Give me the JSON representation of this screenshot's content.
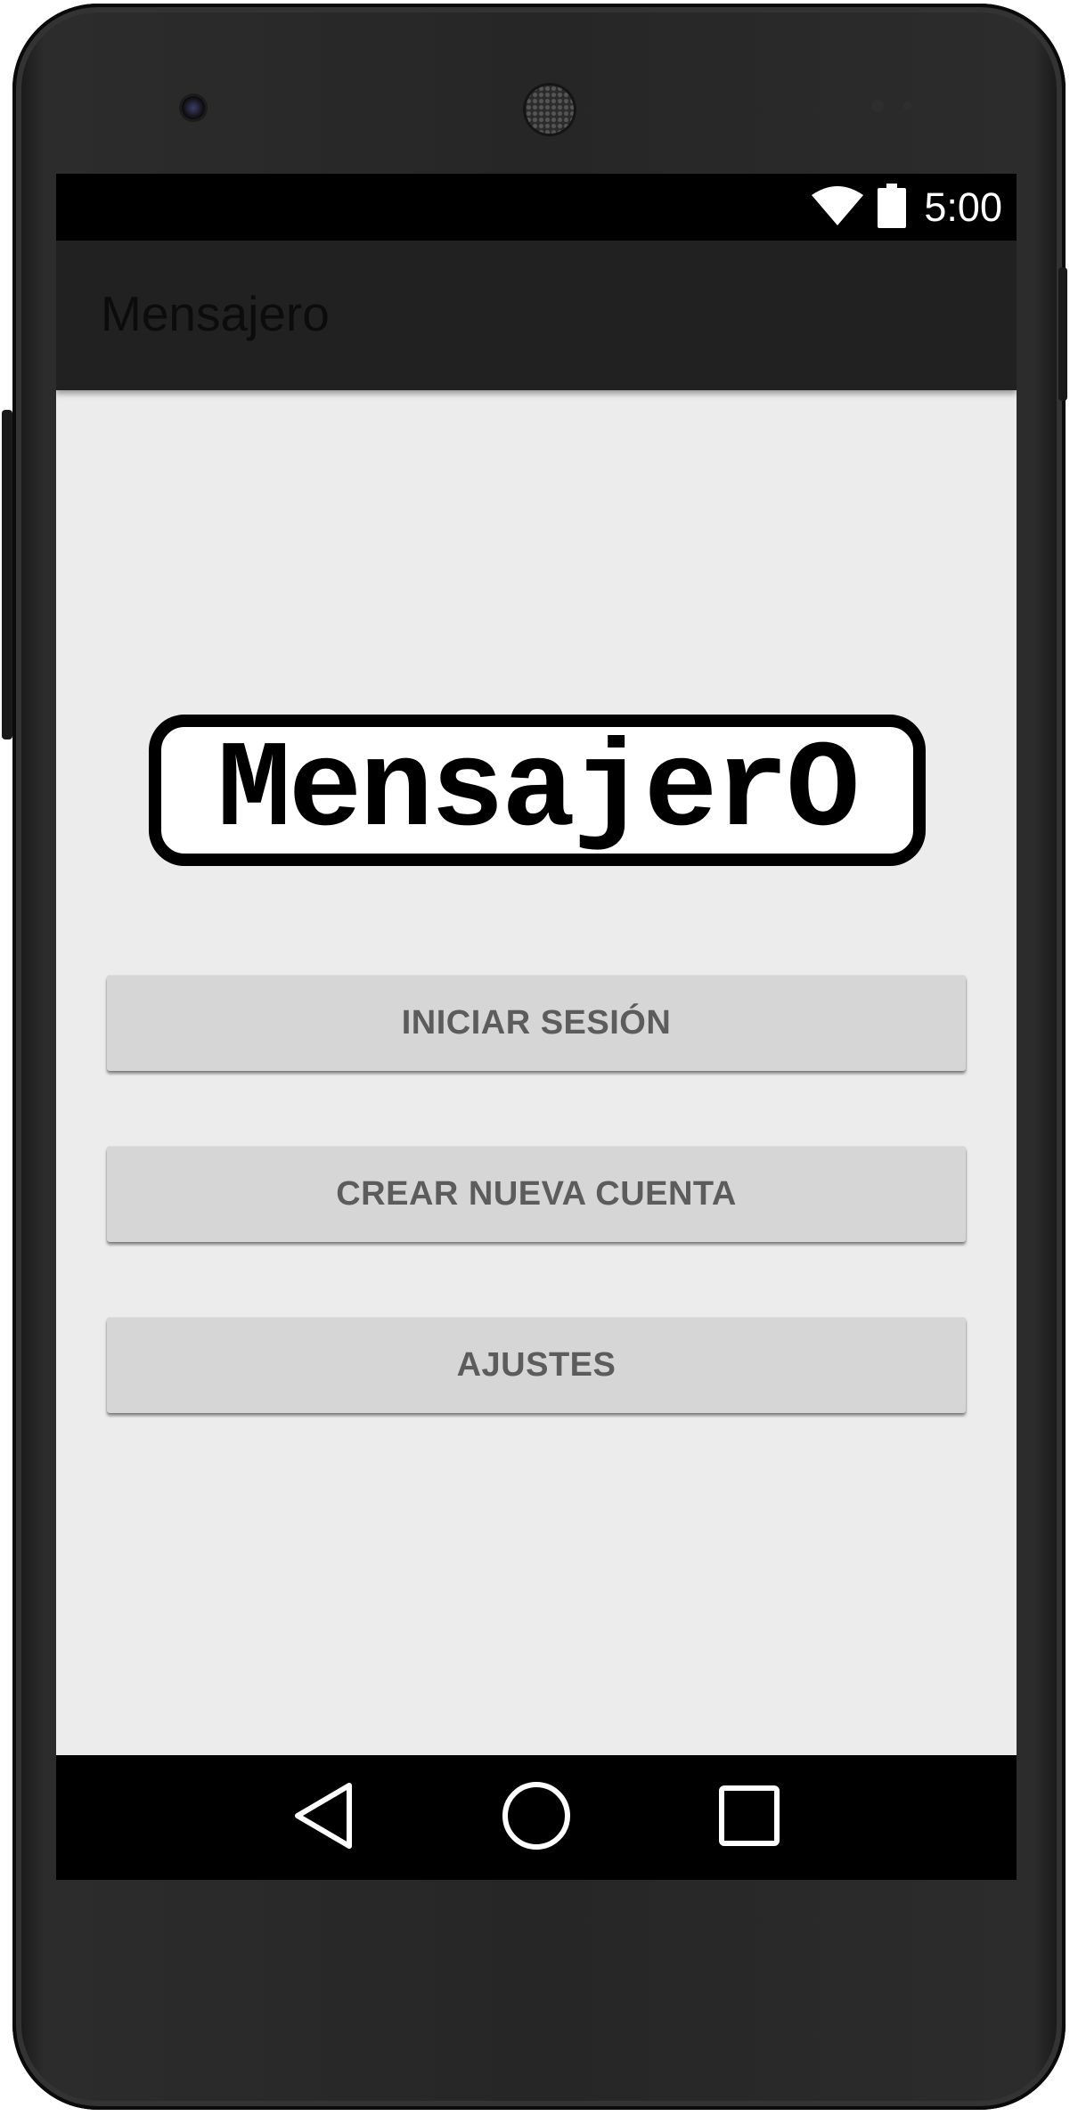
{
  "status_bar": {
    "time": "5:00",
    "icons": [
      "wifi-icon",
      "battery-icon"
    ]
  },
  "app_bar": {
    "title": "Mensajero"
  },
  "logo": {
    "text": "MensajerO"
  },
  "buttons": {
    "login": "INICIAR SESIÓN",
    "create_account": "CREAR NUEVA CUENTA",
    "settings": "AJUSTES"
  },
  "nav_bar": {
    "icons": [
      "back-icon",
      "home-icon",
      "recents-icon"
    ]
  },
  "colors": {
    "status_bar": "#000000",
    "app_bar": "#212121",
    "screen_background": "#ececec",
    "button_background": "#d5d6d5",
    "button_text": "#5c5c5c"
  }
}
